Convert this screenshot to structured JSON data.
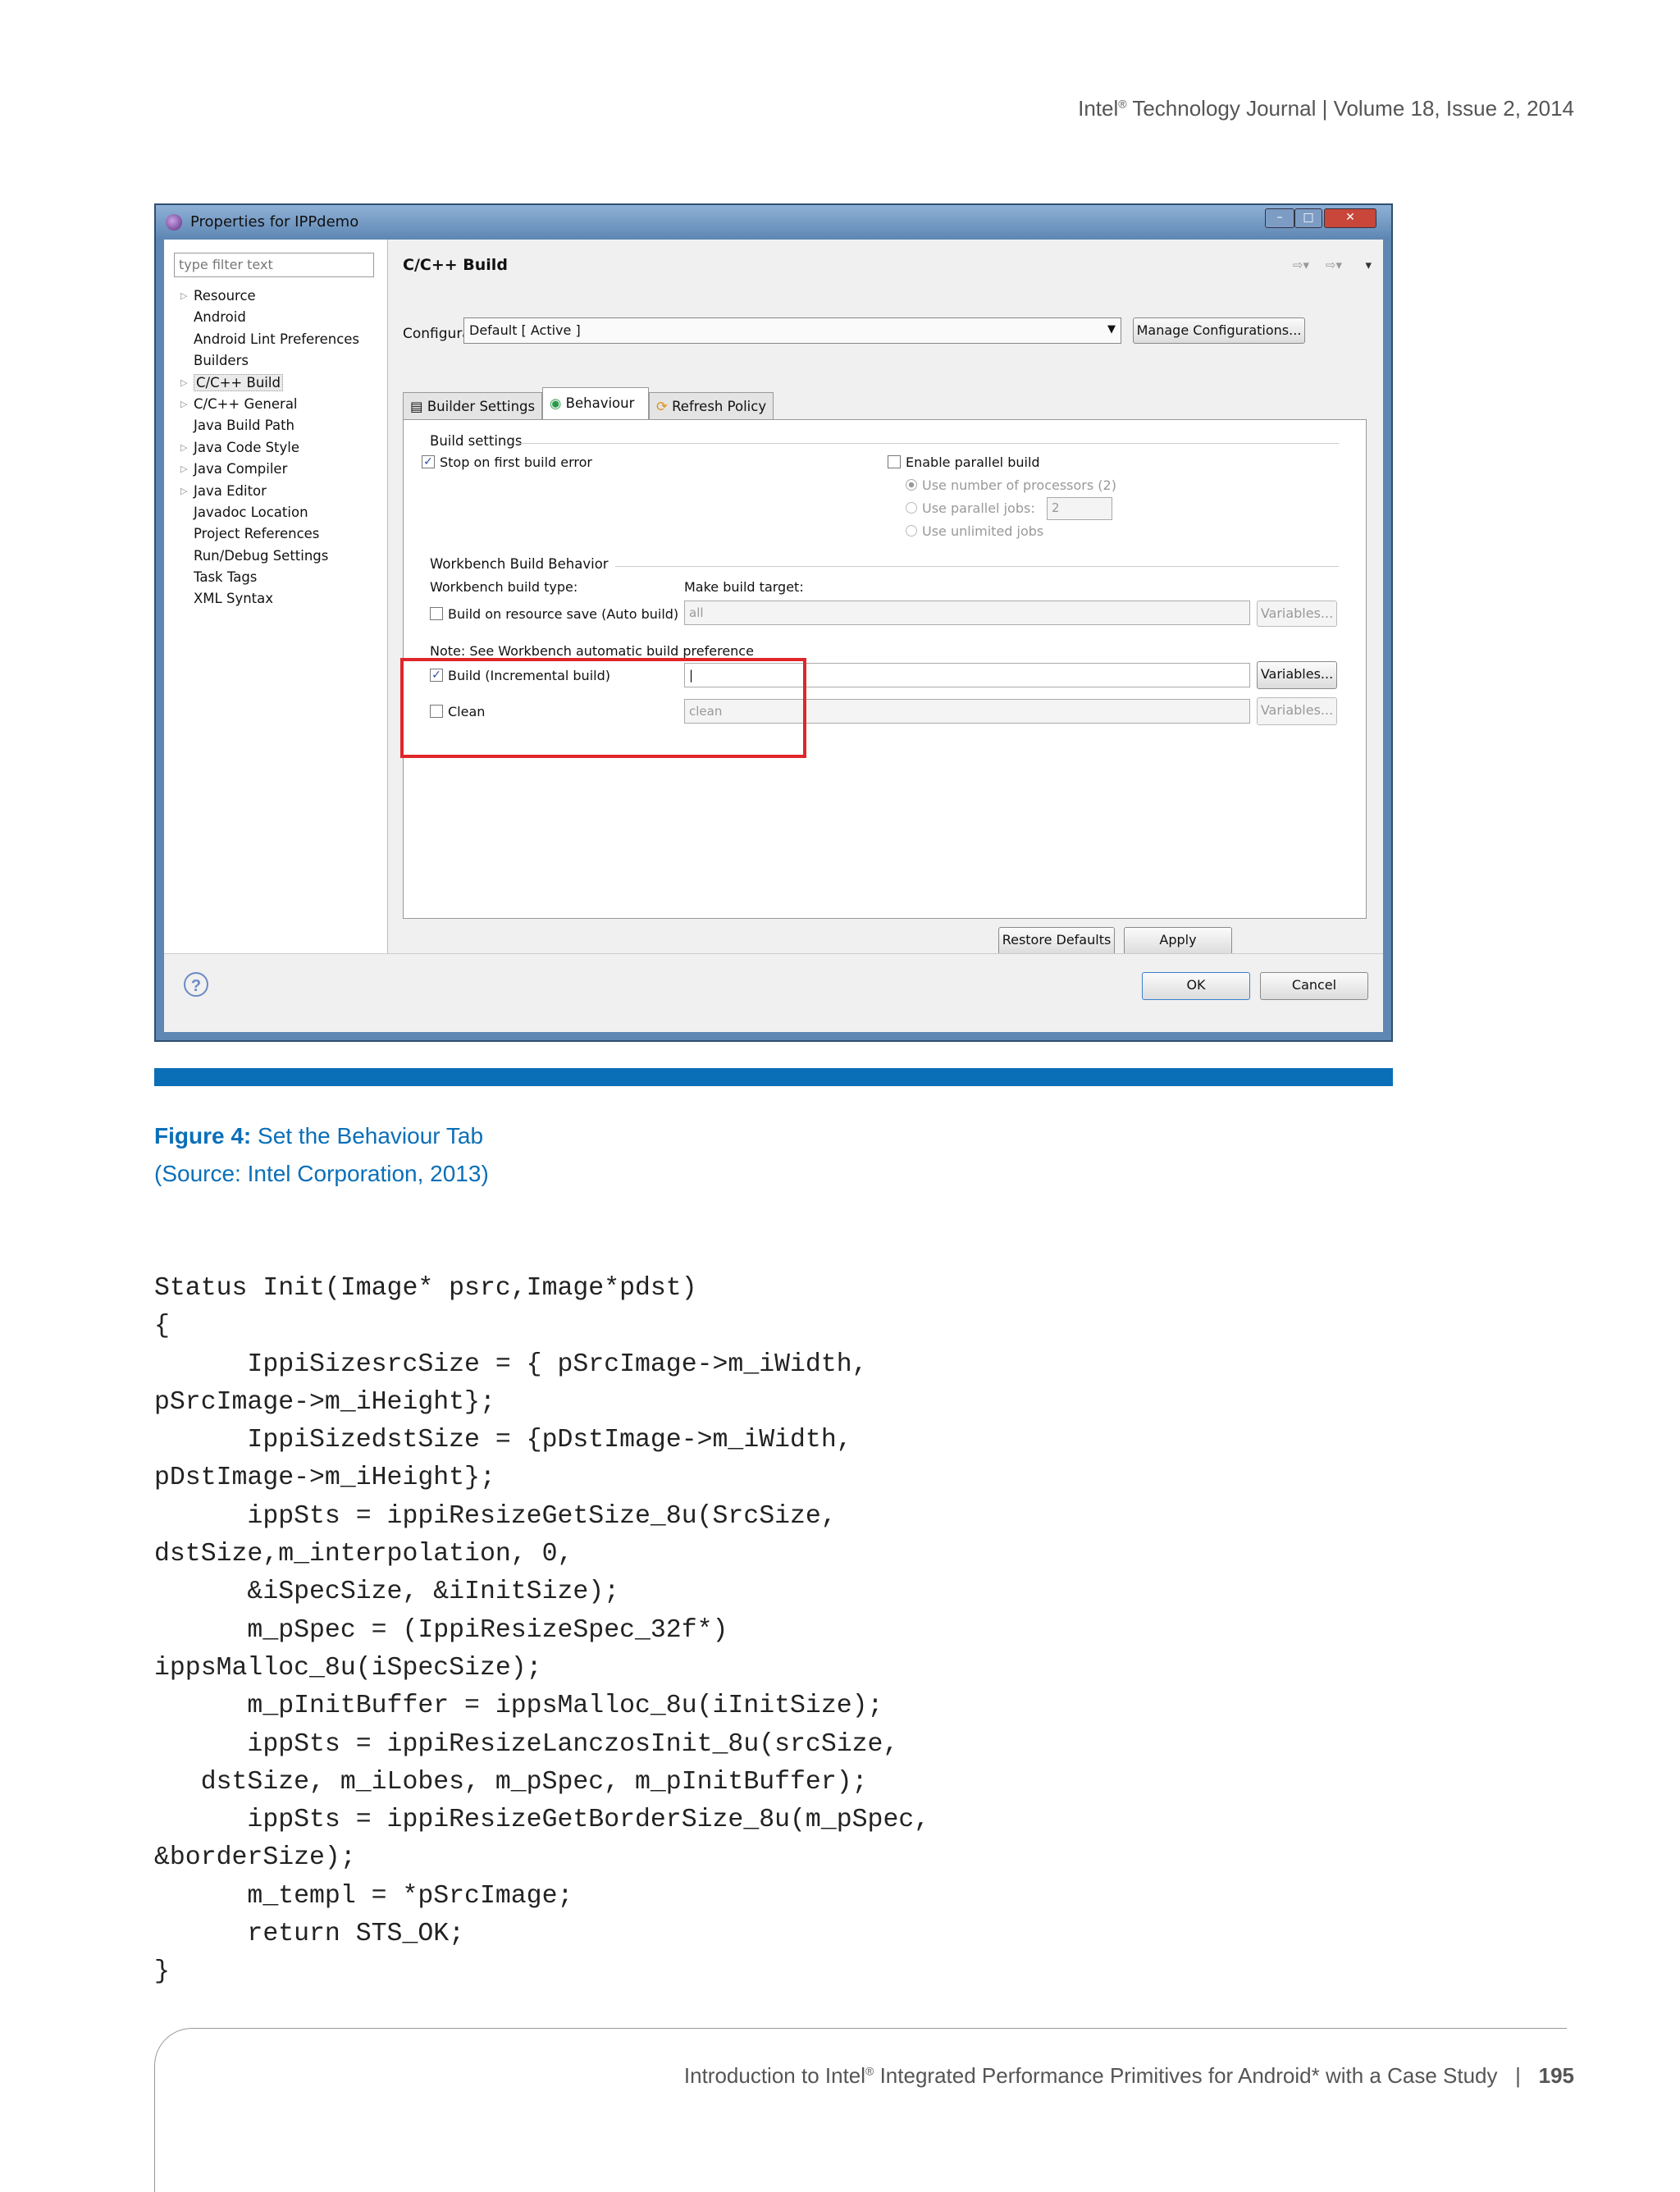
{
  "header": {
    "prefix": "Intel",
    "reg": "®",
    "text": " Technology Journal | Volume 18, Issue 2, 2014"
  },
  "dialog": {
    "title": "Properties for IPPdemo",
    "filter_placeholder": "type filter text",
    "tree": [
      {
        "label": "Resource",
        "expandable": true
      },
      {
        "label": "Android",
        "expandable": false
      },
      {
        "label": "Android Lint Preferences",
        "expandable": false
      },
      {
        "label": "Builders",
        "expandable": false
      },
      {
        "label": "C/C++ Build",
        "expandable": true,
        "selected": true
      },
      {
        "label": "C/C++ General",
        "expandable": true
      },
      {
        "label": "Java Build Path",
        "expandable": false
      },
      {
        "label": "Java Code Style",
        "expandable": true
      },
      {
        "label": "Java Compiler",
        "expandable": true
      },
      {
        "label": "Java Editor",
        "expandable": true
      },
      {
        "label": "Javadoc Location",
        "expandable": false
      },
      {
        "label": "Project References",
        "expandable": false
      },
      {
        "label": "Run/Debug Settings",
        "expandable": false
      },
      {
        "label": "Task Tags",
        "expandable": false
      },
      {
        "label": "XML Syntax",
        "expandable": false
      }
    ],
    "page_title": "C/C++ Build",
    "configuration_label": "Configuration:",
    "configuration_value": "Default  [ Active ]",
    "manage_button": "Manage Configurations...",
    "tabs": [
      {
        "label": "Builder Settings",
        "icon": "list-icon"
      },
      {
        "label": "Behaviour",
        "icon": "radio-icon",
        "active": true
      },
      {
        "label": "Refresh Policy",
        "icon": "refresh-icon"
      }
    ],
    "build_settings": {
      "group": "Build settings",
      "stop_first_error": "Stop on first build error",
      "enable_parallel": "Enable parallel build",
      "use_processors": "Use number of processors (2)",
      "use_parallel_jobs": "Use parallel jobs:",
      "parallel_jobs_value": "2",
      "use_unlimited": "Use unlimited jobs"
    },
    "workbench": {
      "group": "Workbench Build Behavior",
      "type_label": "Workbench build type:",
      "target_label": "Make build target:",
      "auto_build": "Build on resource save (Auto build)",
      "auto_build_value": "all",
      "note": "Note: See Workbench automatic build preference",
      "incremental": "Build (Incremental build)",
      "incremental_value": "|",
      "clean": "Clean",
      "clean_value": "clean",
      "variables": "Variables..."
    },
    "restore_defaults": "Restore Defaults",
    "apply": "Apply",
    "ok": "OK",
    "cancel": "Cancel",
    "help": "?"
  },
  "caption": {
    "label": "Figure 4:",
    "title": " Set the Behaviour Tab",
    "source": "(Source: Intel Corporation, 2013)"
  },
  "code": "Status Init(Image* psrc,Image*pdst)\n{\n      IppiSizesrcSize = { pSrcImage->m_iWidth,\npSrcImage->m_iHeight};\n      IppiSizedstSize = {pDstImage->m_iWidth,\npDstImage->m_iHeight};\n      ippSts = ippiResizeGetSize_8u(SrcSize,\ndstSize,m_interpolation, 0,\n      &iSpecSize, &iInitSize);\n      m_pSpec = (IppiResizeSpec_32f*)\nippsMalloc_8u(iSpecSize);\n      m_pInitBuffer = ippsMalloc_8u(iInitSize);\n      ippSts = ippiResizeLanczosInit_8u(srcSize,\n   dstSize, m_iLobes, m_pSpec, m_pInitBuffer);\n      ippSts = ippiResizeGetBorderSize_8u(m_pSpec,\n&borderSize);\n      m_templ = *pSrcImage;\n      return STS_OK;\n}",
  "footer": {
    "pre": "Introduction to Intel",
    "reg": "®",
    "post": " Integrated Performance Primitives for Android* with a Case Study",
    "sep": "|",
    "page": "195"
  }
}
